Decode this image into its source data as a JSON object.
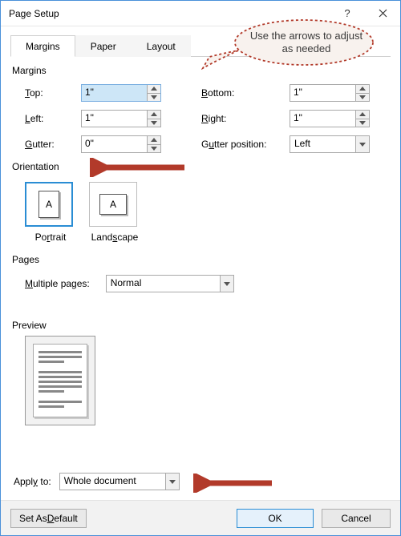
{
  "window": {
    "title": "Page Setup"
  },
  "tabs": {
    "margins": "Margins",
    "paper": "Paper",
    "layout": "Layout"
  },
  "sections": {
    "margins": "Margins",
    "orientation": "Orientation",
    "pages": "Pages",
    "preview": "Preview"
  },
  "margins": {
    "top_label": "Top:",
    "top_value": "1\"",
    "bottom_label": "Bottom:",
    "bottom_value": "1\"",
    "left_label": "Left:",
    "left_value": "1\"",
    "right_label": "Right:",
    "right_value": "1\"",
    "gutter_label": "Gutter:",
    "gutter_value": "0\"",
    "gutter_pos_label": "Gutter position:",
    "gutter_pos_value": "Left"
  },
  "orientation": {
    "portrait": "Portrait",
    "landscape": "Landscape",
    "glyph": "A"
  },
  "pages": {
    "multiple_label": "Multiple pages:",
    "multiple_value": "Normal"
  },
  "apply_to": {
    "label": "Apply to:",
    "value": "Whole document"
  },
  "buttons": {
    "default": "Set As Default",
    "ok": "OK",
    "cancel": "Cancel"
  },
  "callout": {
    "text": "Use the arrows to adjust as needed"
  }
}
